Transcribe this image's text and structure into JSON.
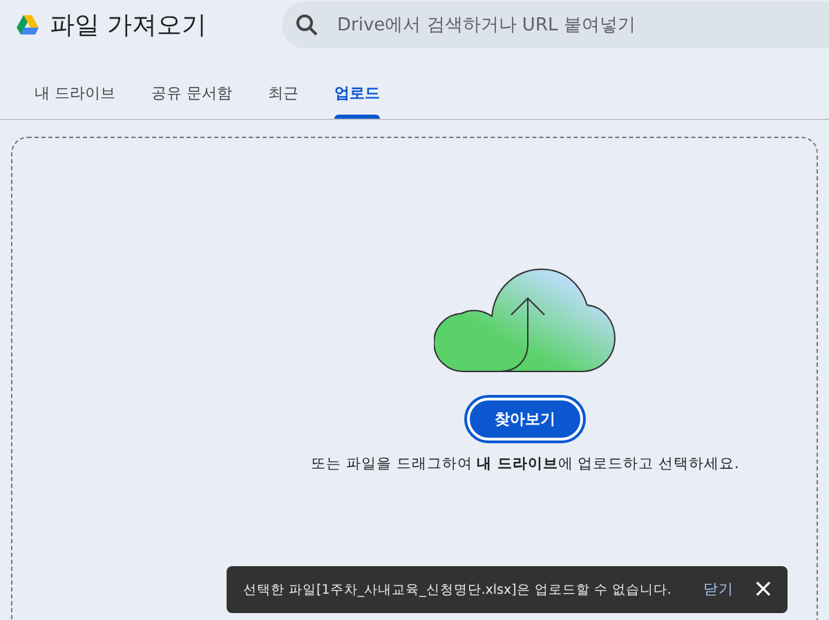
{
  "header": {
    "title": "파일 가져오기",
    "search": {
      "placeholder": "Drive에서 검색하거나 URL 붙여넣기"
    }
  },
  "tabs": [
    {
      "label": "내 드라이브",
      "selected": false
    },
    {
      "label": "공유 문서함",
      "selected": false
    },
    {
      "label": "최근",
      "selected": false
    },
    {
      "label": "업로드",
      "selected": true
    }
  ],
  "upload": {
    "button": "찾아보기",
    "instruction": "또는 파일을 드래그하여 **내 드라이브**에 업로드하고 선택하세요."
  },
  "snackbar": {
    "message": "선택한 파일[1주차_사내교육_신청명단.xlsx]은 업로드할 수 없습니다.",
    "action": "닫기",
    "close": "×"
  }
}
